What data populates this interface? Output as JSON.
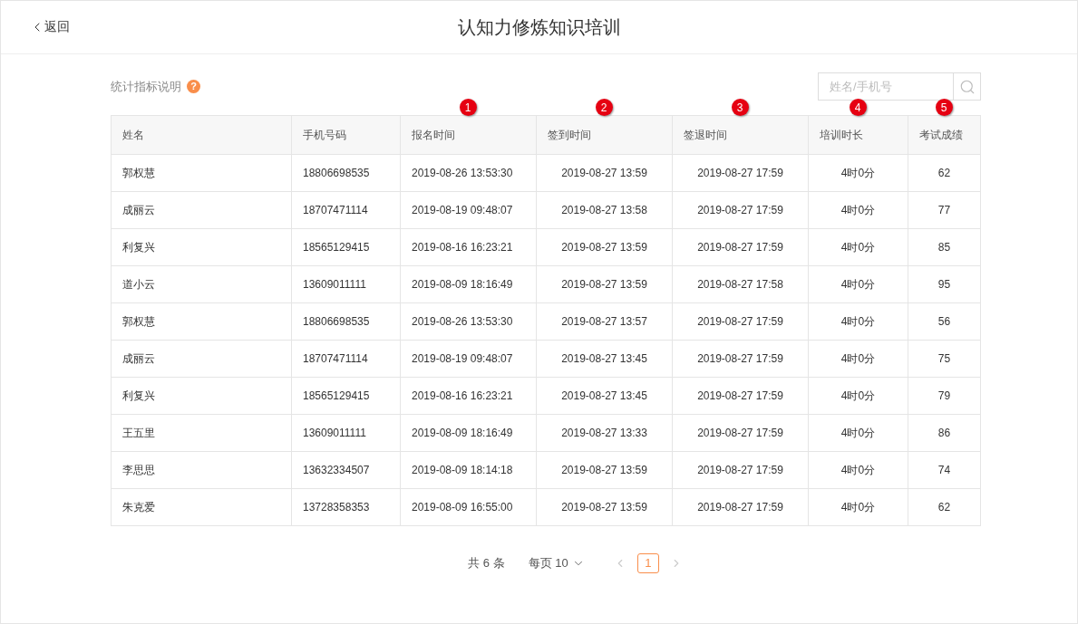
{
  "header": {
    "back": "返回",
    "title": "认知力修炼知识培训"
  },
  "toolbar": {
    "stats_label": "统计指标说明",
    "help_icon": "?",
    "search": {
      "placeholder": "姓名/手机号"
    }
  },
  "table": {
    "columns": [
      {
        "label": "姓名"
      },
      {
        "label": "手机号码"
      },
      {
        "label": "报名时间",
        "badge": "1"
      },
      {
        "label": "签到时间",
        "badge": "2"
      },
      {
        "label": "签退时间",
        "badge": "3"
      },
      {
        "label": "培训时长",
        "badge": "4"
      },
      {
        "label": "考试成绩",
        "badge": "5"
      }
    ],
    "rows": [
      [
        "郭权慧",
        "18806698535",
        "2019-08-26 13:53:30",
        "2019-08-27 13:59",
        "2019-08-27 17:59",
        "4时0分",
        "62"
      ],
      [
        "成丽云",
        "18707471114",
        "2019-08-19 09:48:07",
        "2019-08-27 13:58",
        "2019-08-27 17:59",
        "4时0分",
        "77"
      ],
      [
        "利复兴",
        "18565129415",
        "2019-08-16 16:23:21",
        "2019-08-27 13:59",
        "2019-08-27 17:59",
        "4时0分",
        "85"
      ],
      [
        "道小云",
        "13609011111",
        "2019-08-09 18:16:49",
        "2019-08-27 13:59",
        "2019-08-27 17:58",
        "4时0分",
        "95"
      ],
      [
        "郭权慧",
        "18806698535",
        "2019-08-26 13:53:30",
        "2019-08-27 13:57",
        "2019-08-27 17:59",
        "4时0分",
        "56"
      ],
      [
        "成丽云",
        "18707471114",
        "2019-08-19 09:48:07",
        "2019-08-27 13:45",
        "2019-08-27 17:59",
        "4时0分",
        "75"
      ],
      [
        "利复兴",
        "18565129415",
        "2019-08-16 16:23:21",
        "2019-08-27 13:45",
        "2019-08-27 17:59",
        "4时0分",
        "79"
      ],
      [
        "王五里",
        "13609011111",
        "2019-08-09 18:16:49",
        "2019-08-27 13:33",
        "2019-08-27 17:59",
        "4时0分",
        "86"
      ],
      [
        "李思思",
        "13632334507",
        "2019-08-09 18:14:18",
        "2019-08-27 13:59",
        "2019-08-27 17:59",
        "4时0分",
        "74"
      ],
      [
        "朱克爱",
        "13728358353",
        "2019-08-09 16:55:00",
        "2019-08-27 13:59",
        "2019-08-27 17:59",
        "4时0分",
        "62"
      ]
    ]
  },
  "pagination": {
    "total": "共 6 条",
    "page_size": "每页 10",
    "pages": [
      {
        "label": "1",
        "selected": true
      }
    ]
  }
}
